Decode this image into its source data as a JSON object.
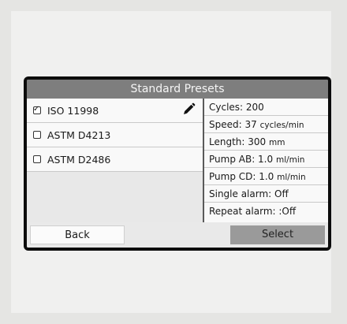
{
  "screen_title": "Standard Presets",
  "presets": [
    {
      "label": "ISO 11998",
      "checked": true,
      "editable": true
    },
    {
      "label": "ASTM D4213",
      "checked": false,
      "editable": false
    },
    {
      "label": "ASTM D2486",
      "checked": false,
      "editable": false
    }
  ],
  "details": {
    "cycles": "Cycles: 200",
    "speed": "Speed: 37",
    "speed_unit": "cycles/min",
    "length": "Length: 300",
    "length_unit": "mm",
    "pump_ab": "Pump AB: 1.0",
    "pump_ab_unit": "ml/min",
    "pump_cd": "Pump CD: 1.0",
    "pump_cd_unit": "ml/min",
    "single_alarm": "Single alarm: Off",
    "repeat_alarm": "Repeat alarm: :Off"
  },
  "buttons": {
    "back": "Back",
    "select": "Select"
  },
  "icons": {
    "checked": "checkbox-checked-icon",
    "unchecked": "checkbox-empty-icon",
    "edit": "pencil-icon"
  },
  "colors": {
    "title_bar": "#7e7e7e",
    "select_button": "#9a9a9a",
    "bezel": "#0c0c0c"
  }
}
